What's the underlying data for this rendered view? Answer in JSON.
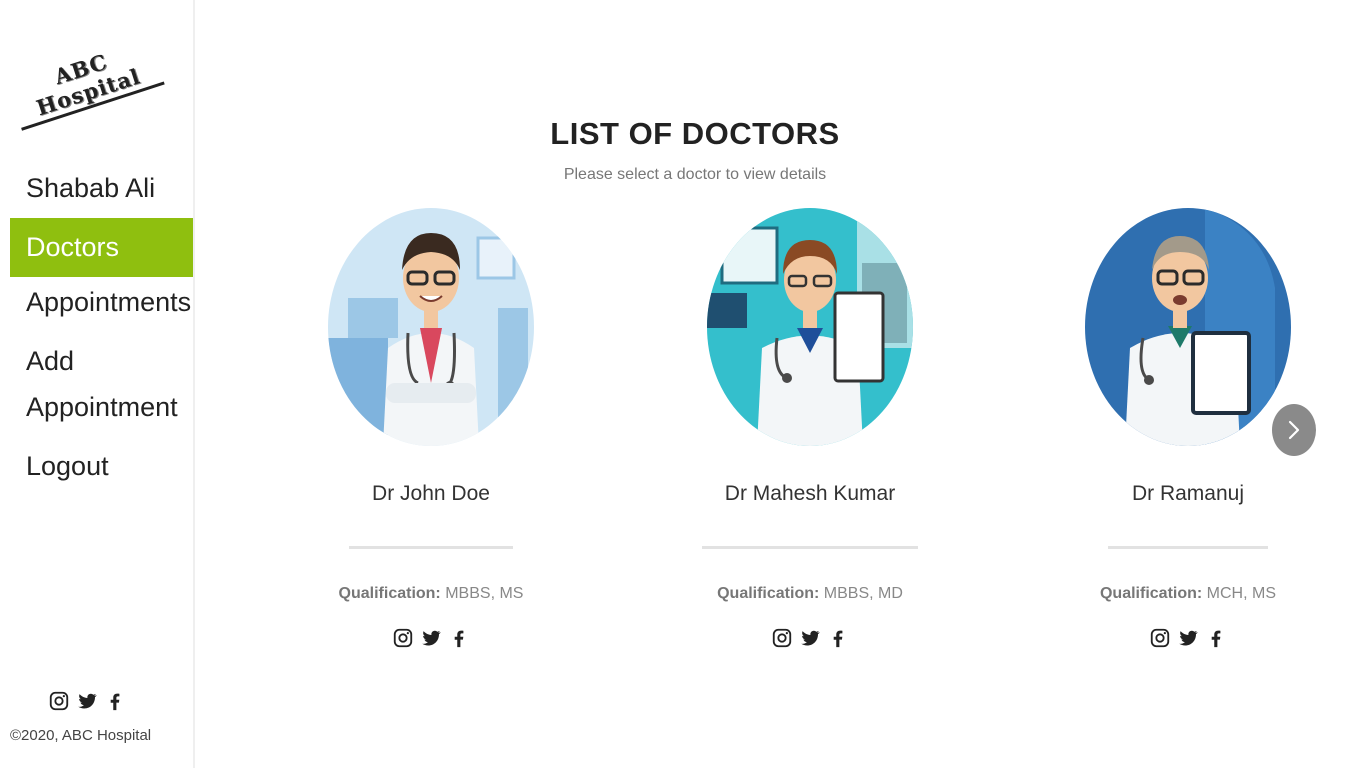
{
  "brand": {
    "logo_text": "ABC Hospital"
  },
  "sidebar": {
    "items": [
      {
        "label": "Shabab Ali",
        "active": false
      },
      {
        "label": "Doctors",
        "active": true
      },
      {
        "label": "Appointments",
        "active": false
      },
      {
        "label": "Add Appointment",
        "active": false
      },
      {
        "label": "Logout",
        "active": false
      }
    ],
    "social_icons": [
      "instagram-icon",
      "twitter-icon",
      "facebook-icon"
    ],
    "copyright": "©2020, ABC Hospital"
  },
  "main": {
    "title": "LIST OF DOCTORS",
    "subtitle": "Please select a doctor to view details",
    "qualification_label": "Qualification:",
    "doctors": [
      {
        "name": "Dr John Doe",
        "qualification": "MBBS, MS"
      },
      {
        "name": "Dr Mahesh Kumar",
        "qualification": "MBBS, MD"
      },
      {
        "name": "Dr Ramanuj",
        "qualification": "MCH, MS"
      }
    ],
    "carousel_next_icon": "chevron-right-icon"
  },
  "colors": {
    "accent": "#8fbf0f",
    "avatar_bg_1": "#cfe6f5",
    "avatar_bg_2": "#34bfcc",
    "avatar_bg_3": "#2f6fb0"
  }
}
